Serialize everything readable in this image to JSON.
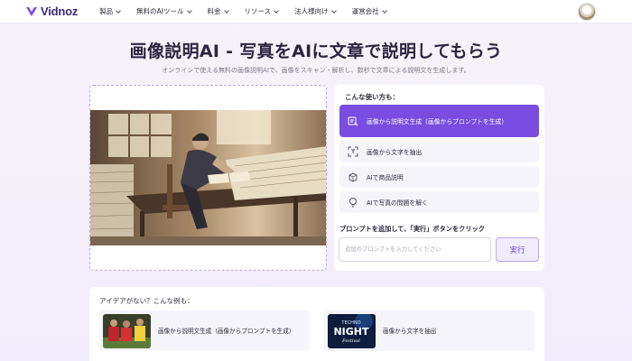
{
  "nav": {
    "logo": "Vidnoz",
    "items": [
      {
        "label": "製品"
      },
      {
        "label": "無料のAIツール"
      },
      {
        "label": "料金"
      },
      {
        "label": "リソース"
      },
      {
        "label": "法人様向け"
      },
      {
        "label": "運営会社"
      }
    ]
  },
  "page": {
    "title": "画像説明AI - 写真をAIに文章で説明してもらう",
    "subtitle": "オンラインで使える無料の画像説明AIで、画像をスキャン・解析し、数秒で文章による説明文を生成します。"
  },
  "usage": {
    "heading": "こんな使い方も：",
    "options": [
      {
        "label": "画像から説明文生成（画像からプロンプトを生成）",
        "icon": "image-to-text-icon",
        "active": true
      },
      {
        "label": "画像から文字を抽出",
        "icon": "text-scan-icon",
        "active": false
      },
      {
        "label": "AIで商品説明",
        "icon": "product-icon",
        "active": false
      },
      {
        "label": "AIで写真の問題を解く",
        "icon": "lightbulb-icon",
        "active": false
      }
    ]
  },
  "prompt": {
    "heading": "プロンプトを追加して、「実行」ボタンをクリック",
    "placeholder": "追加のプロンプトを入力してください",
    "value": "",
    "run_label": "実行"
  },
  "examples": {
    "heading": "アイデアがない？こんな例も：",
    "cards": [
      {
        "label": "画像から説明文生成（画像からプロンプトを生成）",
        "thumb": "soccer-players-photo"
      },
      {
        "label": "画像から文字を抽出",
        "thumb": "techno-night-festival-poster",
        "poster_lines": [
          "TECHNO",
          "NIGHT",
          "Festival"
        ]
      }
    ]
  },
  "colors": {
    "accent": "#7a4ce0",
    "accent_light": "#f1ecfc",
    "title": "#2b2440"
  }
}
